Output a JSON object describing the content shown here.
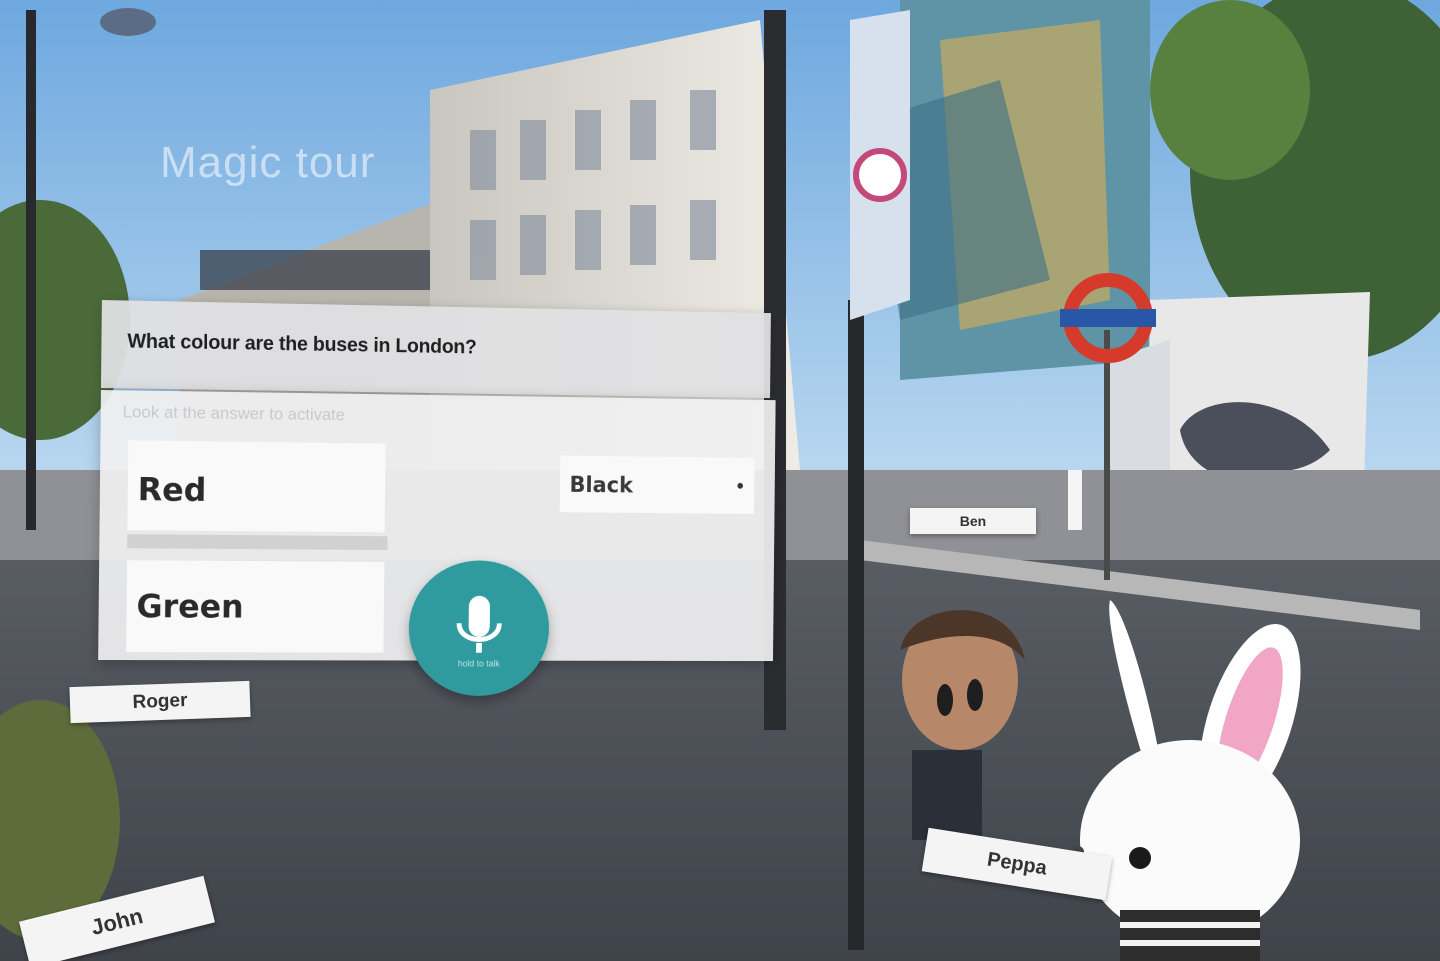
{
  "scene": {
    "title_overlay": "Magic tour",
    "background": "london-street-vr-panorama"
  },
  "quiz": {
    "question": "What colour are the buses in London?",
    "instruction": "Look at the answer to activate",
    "answers": [
      {
        "label": "Red"
      },
      {
        "label": "Green"
      },
      {
        "label": "Black"
      }
    ],
    "mic": {
      "icon": "microphone-icon",
      "label": "hold to talk",
      "color": "#2f9b9e"
    }
  },
  "participants": [
    {
      "name": "Roger"
    },
    {
      "name": "John"
    },
    {
      "name": "Ben"
    },
    {
      "name": "Peppa"
    }
  ],
  "colors": {
    "accent": "#2f9b9e",
    "roundel_red": "#d63a2a",
    "roundel_blue": "#2a56a8"
  }
}
